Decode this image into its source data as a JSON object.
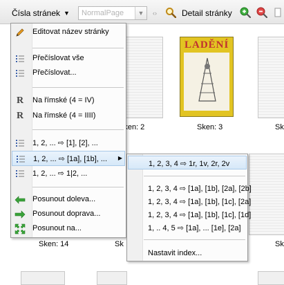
{
  "toolbar": {
    "dropdown_label": "Čísla stránek",
    "page_type_placeholder": "NormalPage",
    "detail_label": "Detail stránky"
  },
  "thumbs": {
    "label_2": "Sken: 2",
    "label_3": "Sken: 3",
    "label_partial": "Sk",
    "label_14": "Sken: 14",
    "cover_title": "LADĚNÍ"
  },
  "menu": {
    "items": [
      {
        "label": "Editovat název stránky",
        "icon": "pencil-icon"
      },
      {
        "label": "Přečíslovat vše",
        "icon": "numbered-list-icon"
      },
      {
        "label": "Přečíslovat...",
        "icon": "numbered-list-icon"
      },
      {
        "label": "Na římské (4 = IV)",
        "icon": "roman-r-icon"
      },
      {
        "label": "Na římské (4 = IIII)",
        "icon": "roman-r-icon"
      },
      {
        "label": "1, 2, ... ⇨ [1], [2], ...",
        "icon": "numbered-list-icon"
      },
      {
        "label": "1, 2, ... ⇨ [1a], [1b], ...",
        "icon": "numbered-list-icon"
      },
      {
        "label": "1, 2, ... ⇨ 1|2, ...",
        "icon": "numbered-list-icon"
      },
      {
        "label": "Posunout doleva...",
        "icon": "arrow-left-icon"
      },
      {
        "label": "Posunout doprava...",
        "icon": "arrow-right-icon"
      },
      {
        "label": "Posunout na...",
        "icon": "move-to-icon"
      }
    ]
  },
  "submenu": {
    "items": [
      {
        "label": "1, 2, 3, 4 ⇨ 1r, 1v, 2r, 2v"
      },
      {
        "label": "1, 2, 3, 4 ⇨ [1a], [1b], [2a], [2b]"
      },
      {
        "label": "1, 2, 3, 4 ⇨ [1a], [1b], [1c], [2a]"
      },
      {
        "label": "1, 2, 3, 4 ⇨ [1a], [1b], [1c], [1d]"
      },
      {
        "label": "1, .. 4, 5 ⇨ [1a], ... [1e], [2a]"
      },
      {
        "label": "Nastavit index..."
      }
    ]
  },
  "colors": {
    "highlight": "#d6e8f8",
    "zoom_in": "#2e9a2e",
    "zoom_out": "#d33a3a",
    "arrow_green": "#3aa33a"
  }
}
